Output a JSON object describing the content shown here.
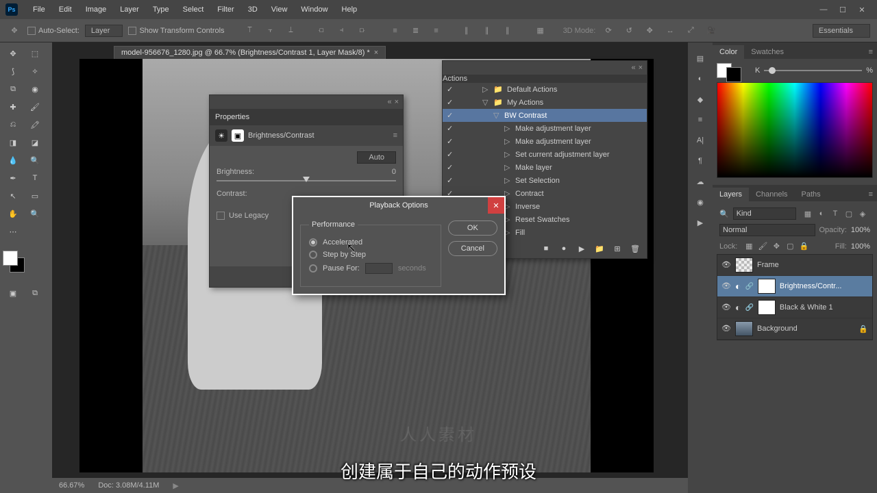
{
  "menubar": {
    "items": [
      "File",
      "Edit",
      "Image",
      "Layer",
      "Type",
      "Select",
      "Filter",
      "3D",
      "View",
      "Window",
      "Help"
    ]
  },
  "optionsbar": {
    "auto_select": "Auto-Select:",
    "layer_dropdown": "Layer",
    "show_transform": "Show Transform Controls",
    "mode3d": "3D Mode:",
    "workspace": "Essentials"
  },
  "tab": {
    "title": "model-956676_1280.jpg @ 66.7% (Brightness/Contrast 1, Layer Mask/8) *"
  },
  "status": {
    "zoom": "66.67%",
    "doc": "Doc: 3.08M/4.11M"
  },
  "properties": {
    "panel_title": "Properties",
    "title": "Brightness/Contrast",
    "auto": "Auto",
    "brightness_label": "Brightness:",
    "brightness_value": "0",
    "contrast_label": "Contrast:",
    "use_legacy": "Use Legacy"
  },
  "actions": {
    "panel_title": "Actions",
    "items": [
      {
        "label": "Default Actions",
        "depth": 0,
        "folder": true,
        "open": false,
        "checked": true
      },
      {
        "label": "My Actions",
        "depth": 0,
        "folder": true,
        "open": true,
        "checked": true
      },
      {
        "label": "BW Contrast",
        "depth": 1,
        "folder": false,
        "open": true,
        "checked": true,
        "sel": true
      },
      {
        "label": "Make adjustment layer",
        "depth": 2,
        "checked": true
      },
      {
        "label": "Make adjustment layer",
        "depth": 2,
        "checked": true
      },
      {
        "label": "Set current adjustment layer",
        "depth": 2,
        "checked": true
      },
      {
        "label": "Make layer",
        "depth": 2,
        "checked": true
      },
      {
        "label": "Set Selection",
        "depth": 2,
        "checked": true
      },
      {
        "label": "Contract",
        "depth": 2,
        "checked": true
      },
      {
        "label": "Inverse",
        "depth": 2,
        "checked": true
      },
      {
        "label": "Reset Swatches",
        "depth": 2
      },
      {
        "label": "Fill",
        "depth": 2
      }
    ]
  },
  "dialog": {
    "title": "Playback Options",
    "legend": "Performance",
    "opt_accel": "Accelerated",
    "opt_step": "Step by Step",
    "opt_pause": "Pause For:",
    "seconds": "seconds",
    "ok": "OK",
    "cancel": "Cancel"
  },
  "color_panel": {
    "tabs": [
      "Color",
      "Swatches"
    ],
    "label": "K",
    "unit": "%"
  },
  "layers_panel": {
    "tabs": [
      "Layers",
      "Channels",
      "Paths"
    ],
    "kind": "Kind",
    "blend": "Normal",
    "opacity_label": "Opacity:",
    "opacity_value": "100%",
    "lock_label": "Lock:",
    "fill_label": "Fill:",
    "fill_value": "100%",
    "layers": [
      {
        "name": "Frame",
        "eye": true,
        "type": "trans"
      },
      {
        "name": "Brightness/Contr...",
        "eye": true,
        "type": "adj",
        "sel": true
      },
      {
        "name": "Black & White 1",
        "eye": true,
        "type": "adj"
      },
      {
        "name": "Background",
        "eye": true,
        "type": "img",
        "locked": true
      }
    ]
  },
  "subtitle": "创建属于自己的动作预设",
  "watermark": "人人素材"
}
